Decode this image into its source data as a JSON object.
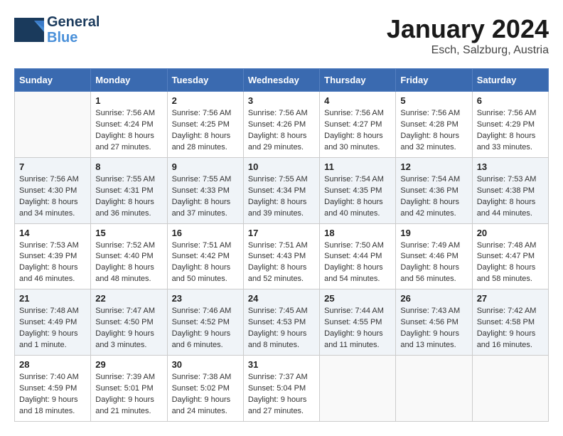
{
  "header": {
    "logo_general": "General",
    "logo_blue": "Blue",
    "month_title": "January 2024",
    "location": "Esch, Salzburg, Austria"
  },
  "weekdays": [
    "Sunday",
    "Monday",
    "Tuesday",
    "Wednesday",
    "Thursday",
    "Friday",
    "Saturday"
  ],
  "weeks": [
    [
      {
        "day": "",
        "sunrise": "",
        "sunset": "",
        "daylight": ""
      },
      {
        "day": "1",
        "sunrise": "Sunrise: 7:56 AM",
        "sunset": "Sunset: 4:24 PM",
        "daylight": "Daylight: 8 hours and 27 minutes."
      },
      {
        "day": "2",
        "sunrise": "Sunrise: 7:56 AM",
        "sunset": "Sunset: 4:25 PM",
        "daylight": "Daylight: 8 hours and 28 minutes."
      },
      {
        "day": "3",
        "sunrise": "Sunrise: 7:56 AM",
        "sunset": "Sunset: 4:26 PM",
        "daylight": "Daylight: 8 hours and 29 minutes."
      },
      {
        "day": "4",
        "sunrise": "Sunrise: 7:56 AM",
        "sunset": "Sunset: 4:27 PM",
        "daylight": "Daylight: 8 hours and 30 minutes."
      },
      {
        "day": "5",
        "sunrise": "Sunrise: 7:56 AM",
        "sunset": "Sunset: 4:28 PM",
        "daylight": "Daylight: 8 hours and 32 minutes."
      },
      {
        "day": "6",
        "sunrise": "Sunrise: 7:56 AM",
        "sunset": "Sunset: 4:29 PM",
        "daylight": "Daylight: 8 hours and 33 minutes."
      }
    ],
    [
      {
        "day": "7",
        "sunrise": "Sunrise: 7:56 AM",
        "sunset": "Sunset: 4:30 PM",
        "daylight": "Daylight: 8 hours and 34 minutes."
      },
      {
        "day": "8",
        "sunrise": "Sunrise: 7:55 AM",
        "sunset": "Sunset: 4:31 PM",
        "daylight": "Daylight: 8 hours and 36 minutes."
      },
      {
        "day": "9",
        "sunrise": "Sunrise: 7:55 AM",
        "sunset": "Sunset: 4:33 PM",
        "daylight": "Daylight: 8 hours and 37 minutes."
      },
      {
        "day": "10",
        "sunrise": "Sunrise: 7:55 AM",
        "sunset": "Sunset: 4:34 PM",
        "daylight": "Daylight: 8 hours and 39 minutes."
      },
      {
        "day": "11",
        "sunrise": "Sunrise: 7:54 AM",
        "sunset": "Sunset: 4:35 PM",
        "daylight": "Daylight: 8 hours and 40 minutes."
      },
      {
        "day": "12",
        "sunrise": "Sunrise: 7:54 AM",
        "sunset": "Sunset: 4:36 PM",
        "daylight": "Daylight: 8 hours and 42 minutes."
      },
      {
        "day": "13",
        "sunrise": "Sunrise: 7:53 AM",
        "sunset": "Sunset: 4:38 PM",
        "daylight": "Daylight: 8 hours and 44 minutes."
      }
    ],
    [
      {
        "day": "14",
        "sunrise": "Sunrise: 7:53 AM",
        "sunset": "Sunset: 4:39 PM",
        "daylight": "Daylight: 8 hours and 46 minutes."
      },
      {
        "day": "15",
        "sunrise": "Sunrise: 7:52 AM",
        "sunset": "Sunset: 4:40 PM",
        "daylight": "Daylight: 8 hours and 48 minutes."
      },
      {
        "day": "16",
        "sunrise": "Sunrise: 7:51 AM",
        "sunset": "Sunset: 4:42 PM",
        "daylight": "Daylight: 8 hours and 50 minutes."
      },
      {
        "day": "17",
        "sunrise": "Sunrise: 7:51 AM",
        "sunset": "Sunset: 4:43 PM",
        "daylight": "Daylight: 8 hours and 52 minutes."
      },
      {
        "day": "18",
        "sunrise": "Sunrise: 7:50 AM",
        "sunset": "Sunset: 4:44 PM",
        "daylight": "Daylight: 8 hours and 54 minutes."
      },
      {
        "day": "19",
        "sunrise": "Sunrise: 7:49 AM",
        "sunset": "Sunset: 4:46 PM",
        "daylight": "Daylight: 8 hours and 56 minutes."
      },
      {
        "day": "20",
        "sunrise": "Sunrise: 7:48 AM",
        "sunset": "Sunset: 4:47 PM",
        "daylight": "Daylight: 8 hours and 58 minutes."
      }
    ],
    [
      {
        "day": "21",
        "sunrise": "Sunrise: 7:48 AM",
        "sunset": "Sunset: 4:49 PM",
        "daylight": "Daylight: 9 hours and 1 minute."
      },
      {
        "day": "22",
        "sunrise": "Sunrise: 7:47 AM",
        "sunset": "Sunset: 4:50 PM",
        "daylight": "Daylight: 9 hours and 3 minutes."
      },
      {
        "day": "23",
        "sunrise": "Sunrise: 7:46 AM",
        "sunset": "Sunset: 4:52 PM",
        "daylight": "Daylight: 9 hours and 6 minutes."
      },
      {
        "day": "24",
        "sunrise": "Sunrise: 7:45 AM",
        "sunset": "Sunset: 4:53 PM",
        "daylight": "Daylight: 9 hours and 8 minutes."
      },
      {
        "day": "25",
        "sunrise": "Sunrise: 7:44 AM",
        "sunset": "Sunset: 4:55 PM",
        "daylight": "Daylight: 9 hours and 11 minutes."
      },
      {
        "day": "26",
        "sunrise": "Sunrise: 7:43 AM",
        "sunset": "Sunset: 4:56 PM",
        "daylight": "Daylight: 9 hours and 13 minutes."
      },
      {
        "day": "27",
        "sunrise": "Sunrise: 7:42 AM",
        "sunset": "Sunset: 4:58 PM",
        "daylight": "Daylight: 9 hours and 16 minutes."
      }
    ],
    [
      {
        "day": "28",
        "sunrise": "Sunrise: 7:40 AM",
        "sunset": "Sunset: 4:59 PM",
        "daylight": "Daylight: 9 hours and 18 minutes."
      },
      {
        "day": "29",
        "sunrise": "Sunrise: 7:39 AM",
        "sunset": "Sunset: 5:01 PM",
        "daylight": "Daylight: 9 hours and 21 minutes."
      },
      {
        "day": "30",
        "sunrise": "Sunrise: 7:38 AM",
        "sunset": "Sunset: 5:02 PM",
        "daylight": "Daylight: 9 hours and 24 minutes."
      },
      {
        "day": "31",
        "sunrise": "Sunrise: 7:37 AM",
        "sunset": "Sunset: 5:04 PM",
        "daylight": "Daylight: 9 hours and 27 minutes."
      },
      {
        "day": "",
        "sunrise": "",
        "sunset": "",
        "daylight": ""
      },
      {
        "day": "",
        "sunrise": "",
        "sunset": "",
        "daylight": ""
      },
      {
        "day": "",
        "sunrise": "",
        "sunset": "",
        "daylight": ""
      }
    ]
  ]
}
